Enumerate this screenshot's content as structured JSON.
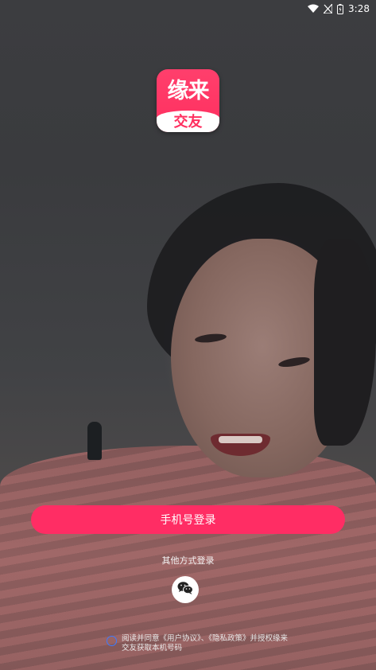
{
  "status_bar": {
    "time": "3:28",
    "icons": [
      "wifi-icon",
      "signal-icon",
      "battery-icon"
    ]
  },
  "logo": {
    "top_text": "缘来",
    "bottom_text": "交友",
    "brand_color": "#ff2f5f"
  },
  "login": {
    "phone_button_label": "手机号登录",
    "other_methods_label": "其他方式登录",
    "wechat_icon": "wechat-icon",
    "accent_color": "#ff2d64"
  },
  "agreement": {
    "text": "阅读并同意《用户协议》、《隐私政策》并授权缘来交友获取本机号码"
  }
}
